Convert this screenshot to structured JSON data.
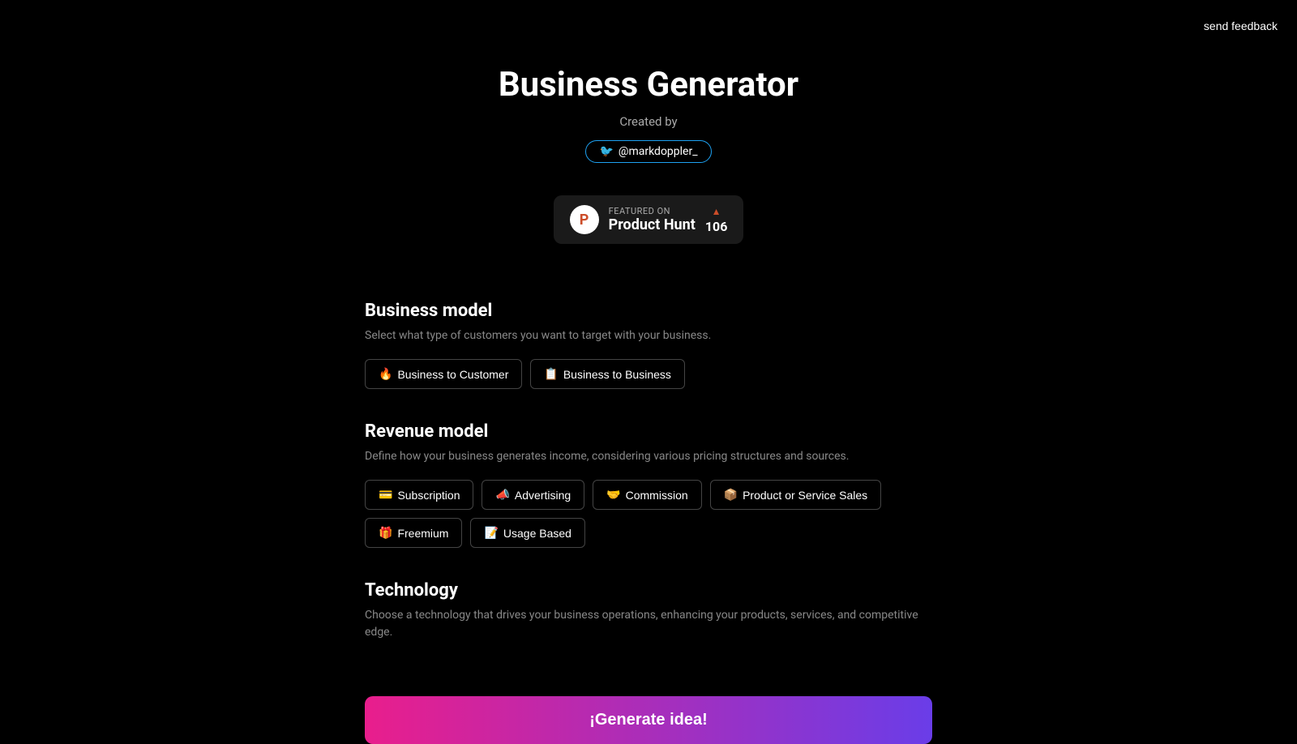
{
  "header": {
    "send_feedback": "send feedback"
  },
  "hero": {
    "title": "Business Generator",
    "created_by": "Created by",
    "twitter_handle": "@markdoppler_",
    "product_hunt": {
      "logo_letter": "P",
      "featured_on": "FEATURED ON",
      "name": "Product Hunt",
      "arrow": "▲",
      "votes": "106"
    }
  },
  "business_model": {
    "title": "Business model",
    "description": "Select what type of customers you want to target with your business.",
    "options": [
      {
        "emoji": "🔥",
        "label": "Business to Customer"
      },
      {
        "emoji": "📋",
        "label": "Business to Business"
      }
    ]
  },
  "revenue_model": {
    "title": "Revenue model",
    "description": "Define how your business generates income, considering various pricing structures and sources.",
    "options": [
      {
        "emoji": "💳",
        "label": "Subscription"
      },
      {
        "emoji": "📣",
        "label": "Advertising"
      },
      {
        "emoji": "🤝",
        "label": "Commission"
      },
      {
        "emoji": "📦",
        "label": "Product or Service Sales"
      },
      {
        "emoji": "🎁",
        "label": "Freemium"
      },
      {
        "emoji": "📝",
        "label": "Usage Based"
      }
    ]
  },
  "technology": {
    "title": "Technology",
    "description": "Choose a technology that drives your business operations, enhancing your products, services, and competitive edge."
  },
  "generate_btn": "¡Generate idea!"
}
